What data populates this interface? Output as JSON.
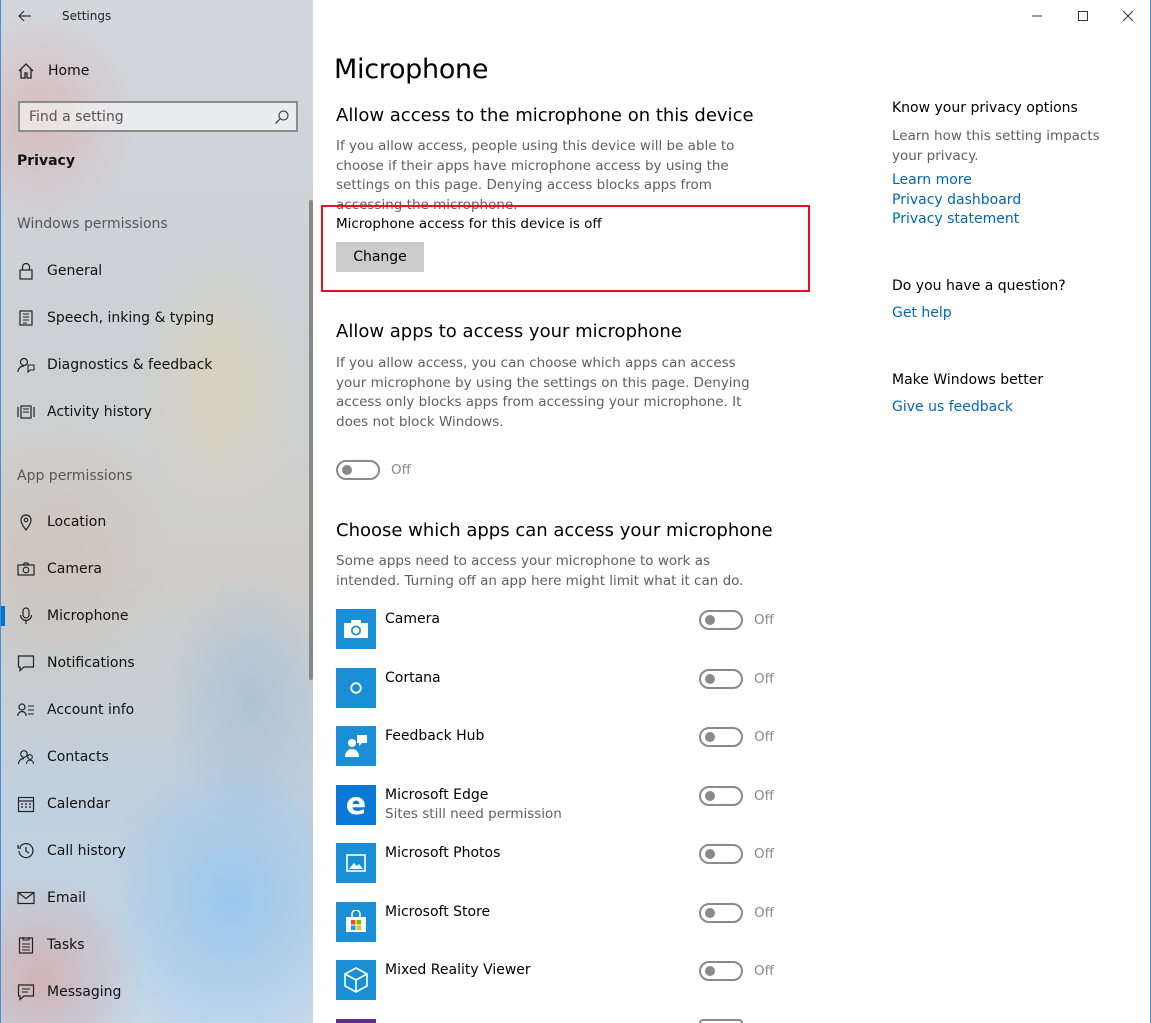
{
  "window": {
    "app_title": "Settings"
  },
  "sidebar": {
    "home_label": "Home",
    "search_placeholder": "Find a setting",
    "current_section": "Privacy",
    "category_windows": "Windows permissions",
    "category_app": "App permissions",
    "windows_items": [
      {
        "label": "General",
        "icon": "lock-icon"
      },
      {
        "label": "Speech, inking & typing",
        "icon": "speech-icon"
      },
      {
        "label": "Diagnostics & feedback",
        "icon": "diagnostics-icon"
      },
      {
        "label": "Activity history",
        "icon": "activity-icon"
      }
    ],
    "app_items": [
      {
        "label": "Location",
        "icon": "location-icon"
      },
      {
        "label": "Camera",
        "icon": "camera-icon"
      },
      {
        "label": "Microphone",
        "icon": "microphone-icon",
        "active": true
      },
      {
        "label": "Notifications",
        "icon": "notifications-icon"
      },
      {
        "label": "Account info",
        "icon": "account-info-icon"
      },
      {
        "label": "Contacts",
        "icon": "contacts-icon"
      },
      {
        "label": "Calendar",
        "icon": "calendar-icon"
      },
      {
        "label": "Call history",
        "icon": "call-history-icon"
      },
      {
        "label": "Email",
        "icon": "email-icon"
      },
      {
        "label": "Tasks",
        "icon": "tasks-icon"
      },
      {
        "label": "Messaging",
        "icon": "messaging-icon"
      }
    ]
  },
  "main": {
    "page_title": "Microphone",
    "device_section": {
      "heading": "Allow access to the microphone on this device",
      "description": "If you allow access, people using this device will be able to choose if their apps have microphone access by using the settings on this page. Denying access blocks apps from accessing the microphone.",
      "status": "Microphone access for this device is off",
      "change_label": "Change"
    },
    "apps_section": {
      "heading": "Allow apps to access your microphone",
      "description": "If you allow access, you can choose which apps can access your microphone by using the settings on this page. Denying access only blocks apps from accessing your microphone. It does not block Windows.",
      "toggle_state": "Off"
    },
    "choose_section": {
      "heading": "Choose which apps can access your microphone",
      "description": "Some apps need to access your microphone to work as intended. Turning off an app here might limit what it can do.",
      "apps": [
        {
          "name": "Camera",
          "subtitle": "",
          "state": "Off",
          "icon": "camera-app-icon"
        },
        {
          "name": "Cortana",
          "subtitle": "",
          "state": "Off",
          "icon": "cortana-app-icon"
        },
        {
          "name": "Feedback Hub",
          "subtitle": "",
          "state": "Off",
          "icon": "feedback-hub-app-icon"
        },
        {
          "name": "Microsoft Edge",
          "subtitle": "Sites still need permission",
          "state": "Off",
          "icon": "edge-app-icon"
        },
        {
          "name": "Microsoft Photos",
          "subtitle": "",
          "state": "Off",
          "icon": "photos-app-icon"
        },
        {
          "name": "Microsoft Store",
          "subtitle": "",
          "state": "Off",
          "icon": "store-app-icon"
        },
        {
          "name": "Mixed Reality Viewer",
          "subtitle": "",
          "state": "Off",
          "icon": "mixed-reality-app-icon"
        }
      ]
    }
  },
  "aside": {
    "privacy_heading": "Know your privacy options",
    "privacy_text": "Learn how this setting impacts your privacy.",
    "links": [
      "Learn more",
      "Privacy dashboard",
      "Privacy statement"
    ],
    "question_heading": "Do you have a question?",
    "help_link": "Get help",
    "better_heading": "Make Windows better",
    "feedback_link": "Give us feedback"
  },
  "colors": {
    "accent": "#0078d7",
    "link": "#0067b8",
    "highlight_border": "#e81123",
    "app_tile": "#1a8fd6"
  }
}
